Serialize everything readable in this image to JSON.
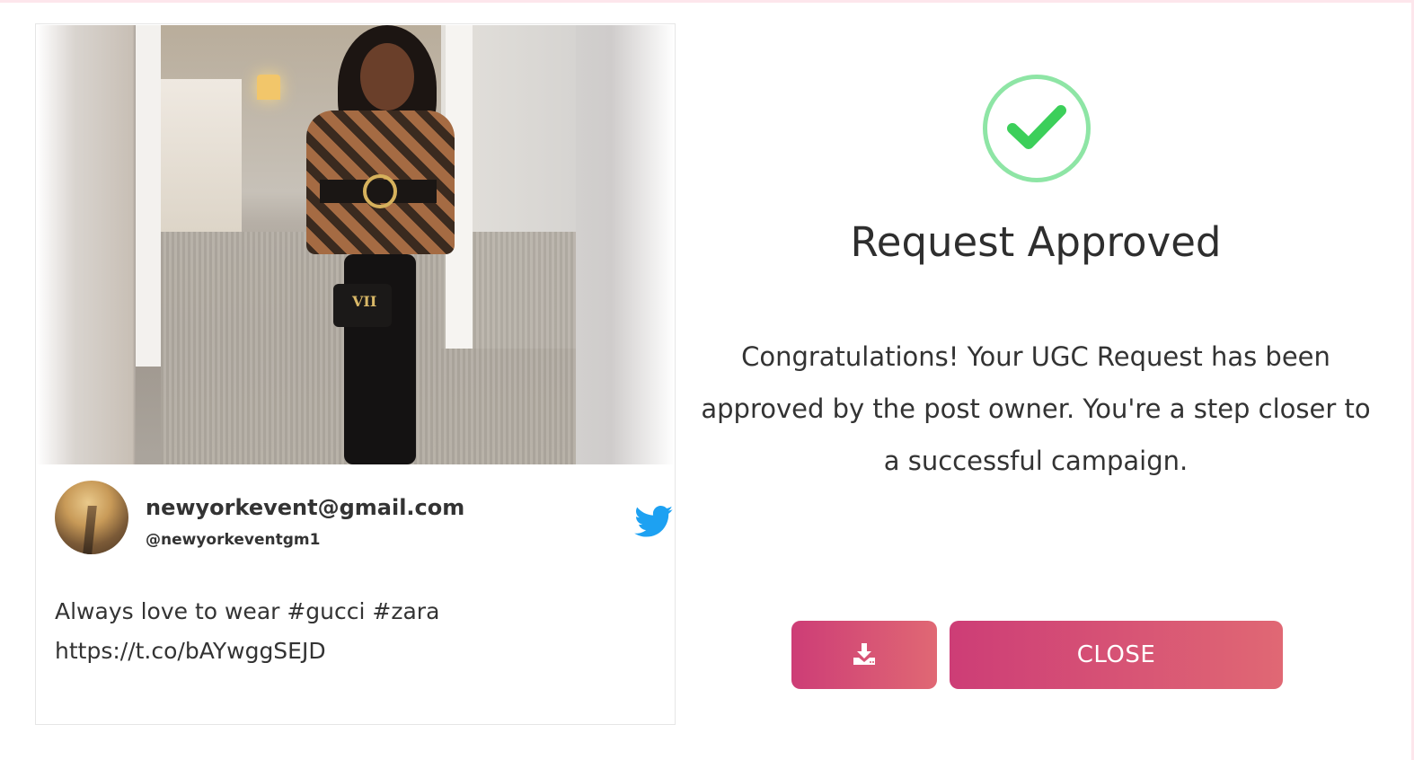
{
  "post": {
    "author_name": "newyorkevent@gmail.com",
    "author_handle": "@newyorkeventgm1",
    "caption_line1": "Always love to wear #gucci #zara",
    "caption_line2": "https://t.co/bAYwggSEJD",
    "platform_icon": "twitter-icon",
    "image_bag_text": "VII"
  },
  "result": {
    "status_icon": "check-circle-icon",
    "title": "Request Approved",
    "message": "Congratulations! Your UGC Request has been approved by the post owner. You're a step closer to a successful campaign."
  },
  "actions": {
    "download_icon": "download-icon",
    "close_label": "CLOSE"
  },
  "colors": {
    "accent_start": "#cd3d76",
    "accent_end": "#e06874",
    "success": "#3ccf5a",
    "success_ring": "#8ee5a5",
    "twitter": "#1da1f2"
  }
}
